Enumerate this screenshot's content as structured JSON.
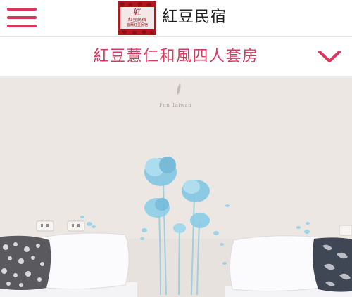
{
  "header": {
    "menu_icon": "hamburger-menu-icon",
    "logo": {
      "mark": "紅",
      "sub": "紅豆民宿",
      "sub2": "宜蘭紅豆民宿"
    },
    "site_name": "紅豆民宿"
  },
  "room_selector": {
    "title": "紅豆薏仁和風四人套房",
    "toggle_icon": "chevron-down-icon"
  },
  "photo": {
    "watermark": "Fun Taiwan"
  },
  "colors": {
    "accent": "#e0355a",
    "title": "#d63a5f",
    "logo_bg": "#b5161d",
    "flower": "#7ec9e0"
  }
}
